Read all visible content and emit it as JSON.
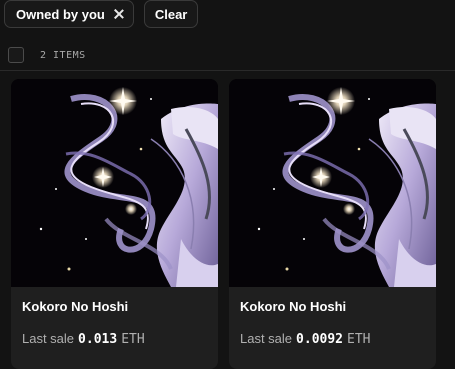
{
  "filters": {
    "owned_chip_label": "Owned by you",
    "clear_label": "Clear"
  },
  "results": {
    "count_label": "2 ITEMS"
  },
  "cards": [
    {
      "name": "Kokoro No Hoshi",
      "sale_label": "Last sale",
      "price": "0.013",
      "currency": "ETH"
    },
    {
      "name": "Kokoro No Hoshi",
      "sale_label": "Last sale",
      "price": "0.0092",
      "currency": "ETH"
    }
  ],
  "colors": {
    "background": "#131313",
    "card": "#1f1f1f",
    "accent_art": "#b7a6e6"
  }
}
